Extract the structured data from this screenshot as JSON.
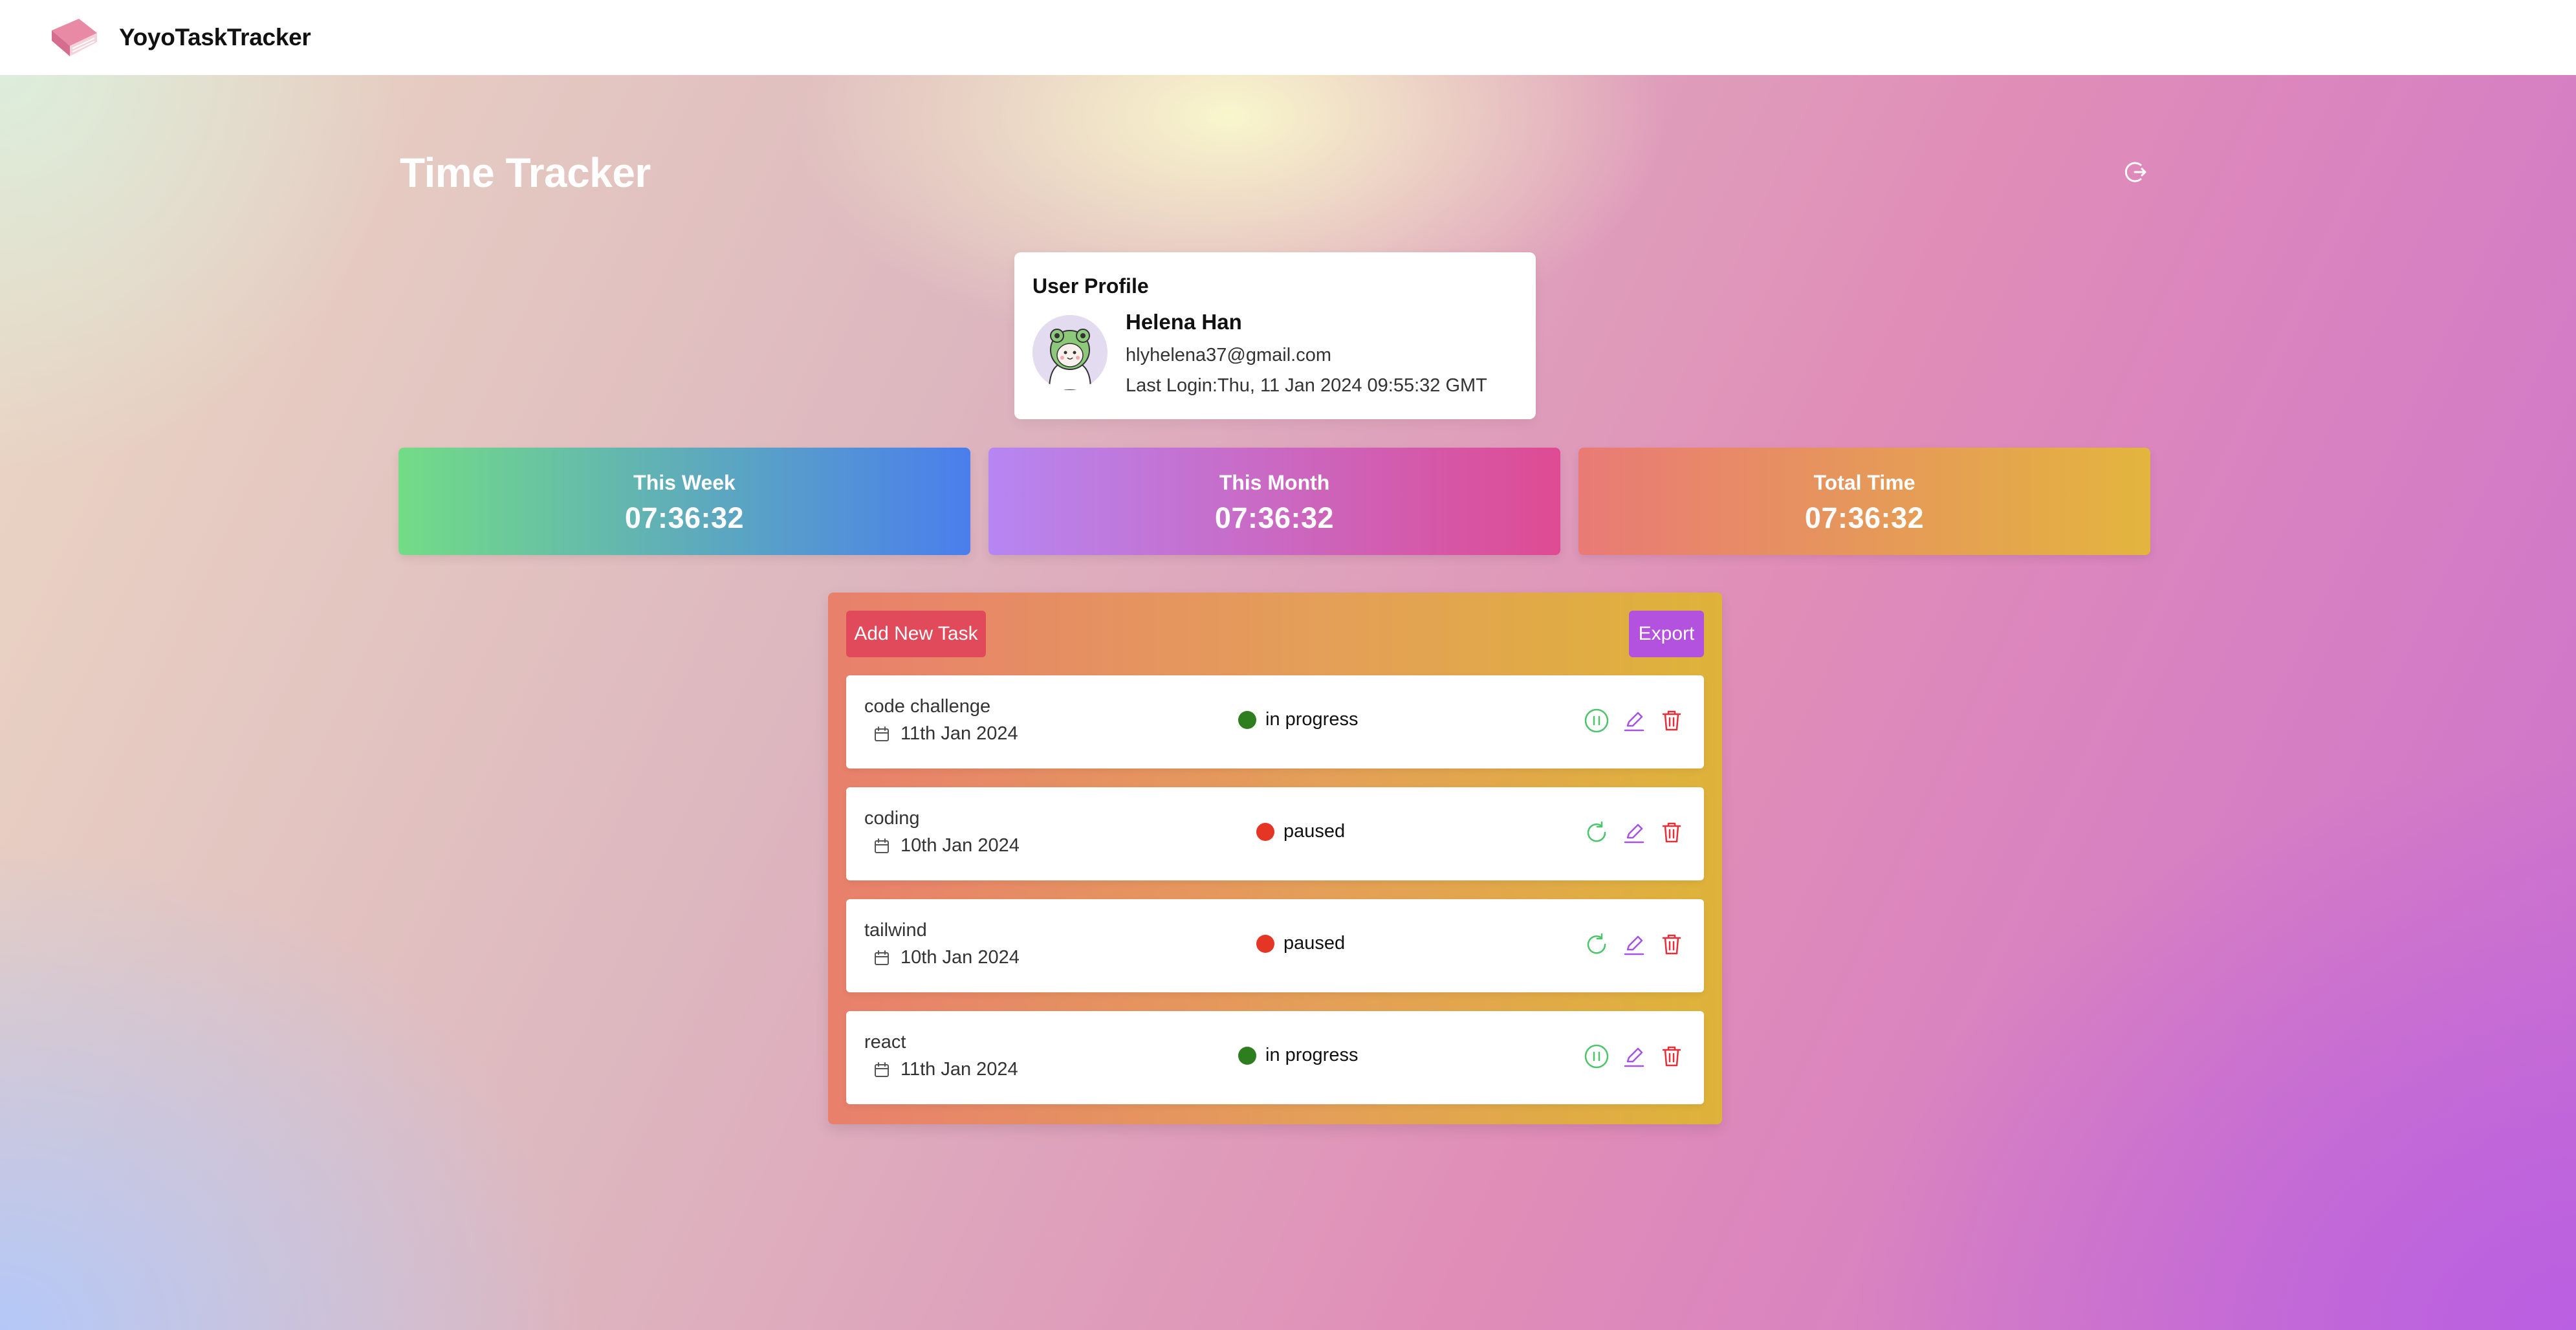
{
  "app": {
    "brand": "YoyoTaskTracker"
  },
  "header": {
    "title": "Time Tracker",
    "logout_icon": "logout-icon"
  },
  "profile": {
    "heading": "User Profile",
    "name": "Helena Han",
    "email": "hlyhelena37@gmail.com",
    "last_login": "Last Login:Thu, 11 Jan 2024 09:55:32 GMT"
  },
  "stats": [
    {
      "label": "This Week",
      "value": "07:36:32"
    },
    {
      "label": "This Month",
      "value": "07:36:32"
    },
    {
      "label": "Total Time",
      "value": "07:36:32"
    }
  ],
  "task_panel": {
    "add_label": "Add New Task",
    "export_label": "Export"
  },
  "tasks": [
    {
      "name": "code challenge",
      "date": "11th Jan 2024",
      "status": "in progress",
      "status_color": "#2e7d1e",
      "action_icon": "pause-icon"
    },
    {
      "name": "coding",
      "date": "10th Jan 2024",
      "status": "paused",
      "status_color": "#e53524",
      "action_icon": "resume-icon"
    },
    {
      "name": "tailwind",
      "date": "10th Jan 2024",
      "status": "paused",
      "status_color": "#e53524",
      "action_icon": "resume-icon"
    },
    {
      "name": "react",
      "date": "11th Jan 2024",
      "status": "in progress",
      "status_color": "#2e7d1e",
      "action_icon": "pause-icon"
    }
  ],
  "colors": {
    "pause_resume_icon": "#4cc46a",
    "edit_icon": "#a552e6",
    "delete_icon": "#e5303b"
  }
}
